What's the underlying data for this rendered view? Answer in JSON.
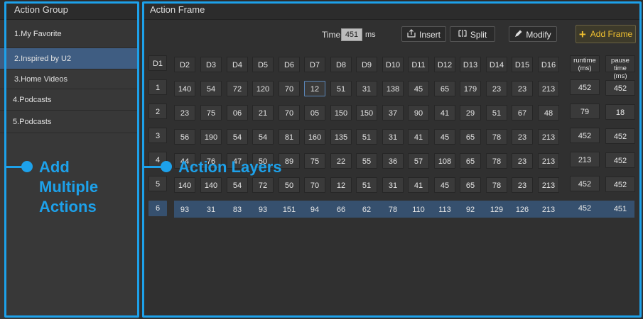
{
  "left_panel": {
    "title": "Action Group",
    "items": [
      {
        "label": "1.My Favorite"
      },
      {
        "label": "2.Inspired by U2"
      },
      {
        "label": "3.Home Videos"
      },
      {
        "label": "4.Podcasts"
      },
      {
        "label": "5.Podcasts"
      }
    ],
    "active_index": 1
  },
  "right_panel": {
    "title": "Action Frame",
    "time_label": "Time",
    "time_value": "451",
    "time_unit": "ms",
    "buttons": {
      "insert": "Insert",
      "split": "Split",
      "modify": "Modify",
      "add_frame": "Add Frame"
    },
    "icons": {
      "insert": "insert-icon",
      "split": "split-icon",
      "modify": "pencil-icon",
      "add_frame": "plus-icon"
    },
    "headers": [
      "D1",
      "D2",
      "D3",
      "D4",
      "D5",
      "D6",
      "D7",
      "D8",
      "D9",
      "D10",
      "D11",
      "D12",
      "D13",
      "D14",
      "D15",
      "D16"
    ],
    "runtime_header": [
      "runtime",
      "(ms)"
    ],
    "pause_header": [
      "pause time",
      "(ms)"
    ],
    "rows": [
      {
        "id": "1",
        "values": [
          "140",
          "54",
          "72",
          "120",
          "70",
          "12",
          "51",
          "31",
          "138",
          "45",
          "65",
          "179",
          "23",
          "23",
          "213"
        ],
        "runtime": "452",
        "pause": "452"
      },
      {
        "id": "2",
        "values": [
          "23",
          "75",
          "06",
          "21",
          "70",
          "05",
          "150",
          "150",
          "37",
          "90",
          "41",
          "29",
          "51",
          "67",
          "48"
        ],
        "runtime": "79",
        "pause": "18"
      },
      {
        "id": "3",
        "values": [
          "56",
          "190",
          "54",
          "54",
          "81",
          "160",
          "135",
          "51",
          "31",
          "41",
          "45",
          "65",
          "78",
          "23",
          "213"
        ],
        "runtime": "452",
        "pause": "452"
      },
      {
        "id": "4",
        "values": [
          "44",
          "76",
          "47",
          "50",
          "89",
          "75",
          "22",
          "55",
          "36",
          "57",
          "108",
          "65",
          "78",
          "23",
          "213"
        ],
        "runtime": "213",
        "pause": "452"
      },
      {
        "id": "5",
        "values": [
          "140",
          "140",
          "54",
          "72",
          "50",
          "70",
          "12",
          "51",
          "31",
          "41",
          "45",
          "65",
          "78",
          "23",
          "213"
        ],
        "runtime": "452",
        "pause": "452"
      },
      {
        "id": "6",
        "values": [
          "93",
          "31",
          "83",
          "93",
          "151",
          "94",
          "66",
          "62",
          "78",
          "110",
          "113",
          "92",
          "129",
          "126",
          "213"
        ],
        "runtime": "452",
        "pause": "451"
      }
    ],
    "selected_row": 5
  },
  "annotations": {
    "left": [
      "Add",
      "Multiple",
      "Actions"
    ],
    "right": "Action Layers"
  },
  "colors": {
    "accent": "#1da1ea",
    "selection": "#3f5d82",
    "add_frame": "#f0c030"
  }
}
